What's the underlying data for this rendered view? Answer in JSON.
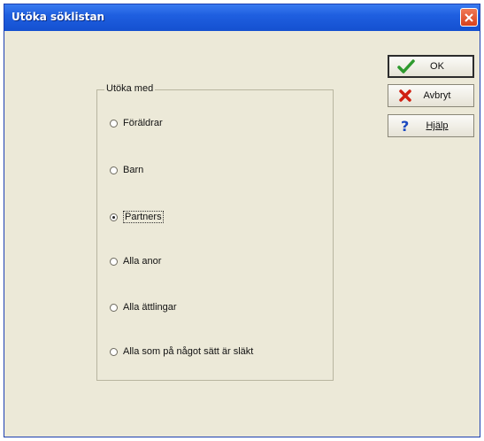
{
  "window": {
    "title": "Utöka söklistan"
  },
  "group": {
    "legend": "Utöka med",
    "options": [
      {
        "label": "Föräldrar",
        "checked": false
      },
      {
        "label": "Barn",
        "checked": false
      },
      {
        "label": "Partners",
        "checked": true,
        "focused": true
      },
      {
        "label": "Alla anor",
        "checked": false
      },
      {
        "label": "Alla ättlingar",
        "checked": false
      },
      {
        "label": "Alla som på något sätt är släkt",
        "checked": false
      }
    ]
  },
  "buttons": {
    "ok": {
      "label": "OK",
      "icon": "checkmark-icon",
      "color": "#2e9a2e"
    },
    "cancel": {
      "label": "Avbryt",
      "icon": "x-icon",
      "color": "#d02010"
    },
    "help": {
      "label": "Hjälp",
      "icon": "question-icon",
      "color": "#1a48c0"
    }
  }
}
